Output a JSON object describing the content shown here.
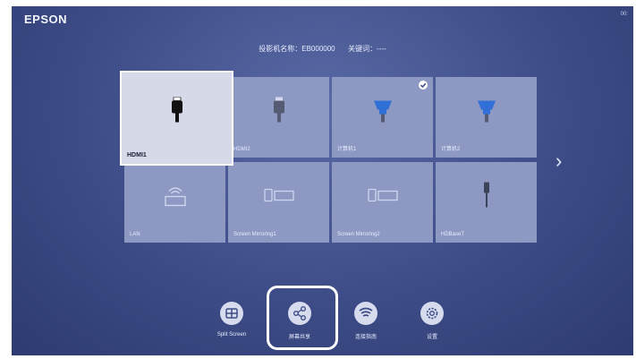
{
  "brand": "EPSON",
  "corner_text": "00:",
  "info": {
    "projector_label": "投影机名称：",
    "projector_name": "EB000000",
    "keyword_label": "关键词：",
    "keyword_value": "----"
  },
  "tiles": [
    {
      "label": "HDMI1"
    },
    {
      "label": "HDMI2"
    },
    {
      "label": "计算机1"
    },
    {
      "label": "计算机2"
    },
    {
      "label": "LAN"
    },
    {
      "label": "Screen Mirroring1"
    },
    {
      "label": "Screen Mirroring2"
    },
    {
      "label": "HDBaseT"
    }
  ],
  "next_icon": "chevron-right-icon",
  "bottom": [
    {
      "label": "Split Screen",
      "icon": "split-screen-icon"
    },
    {
      "label": "屏幕共享",
      "icon": "share-icon"
    },
    {
      "label": "连接指南",
      "icon": "wireless-icon"
    },
    {
      "label": "设置",
      "icon": "gear-icon"
    }
  ],
  "colors": {
    "background": "#3d4c86",
    "tile": "#8d99c3",
    "selected_tile": "#d6d9e8",
    "accent_blue": "#2f6fd6"
  }
}
